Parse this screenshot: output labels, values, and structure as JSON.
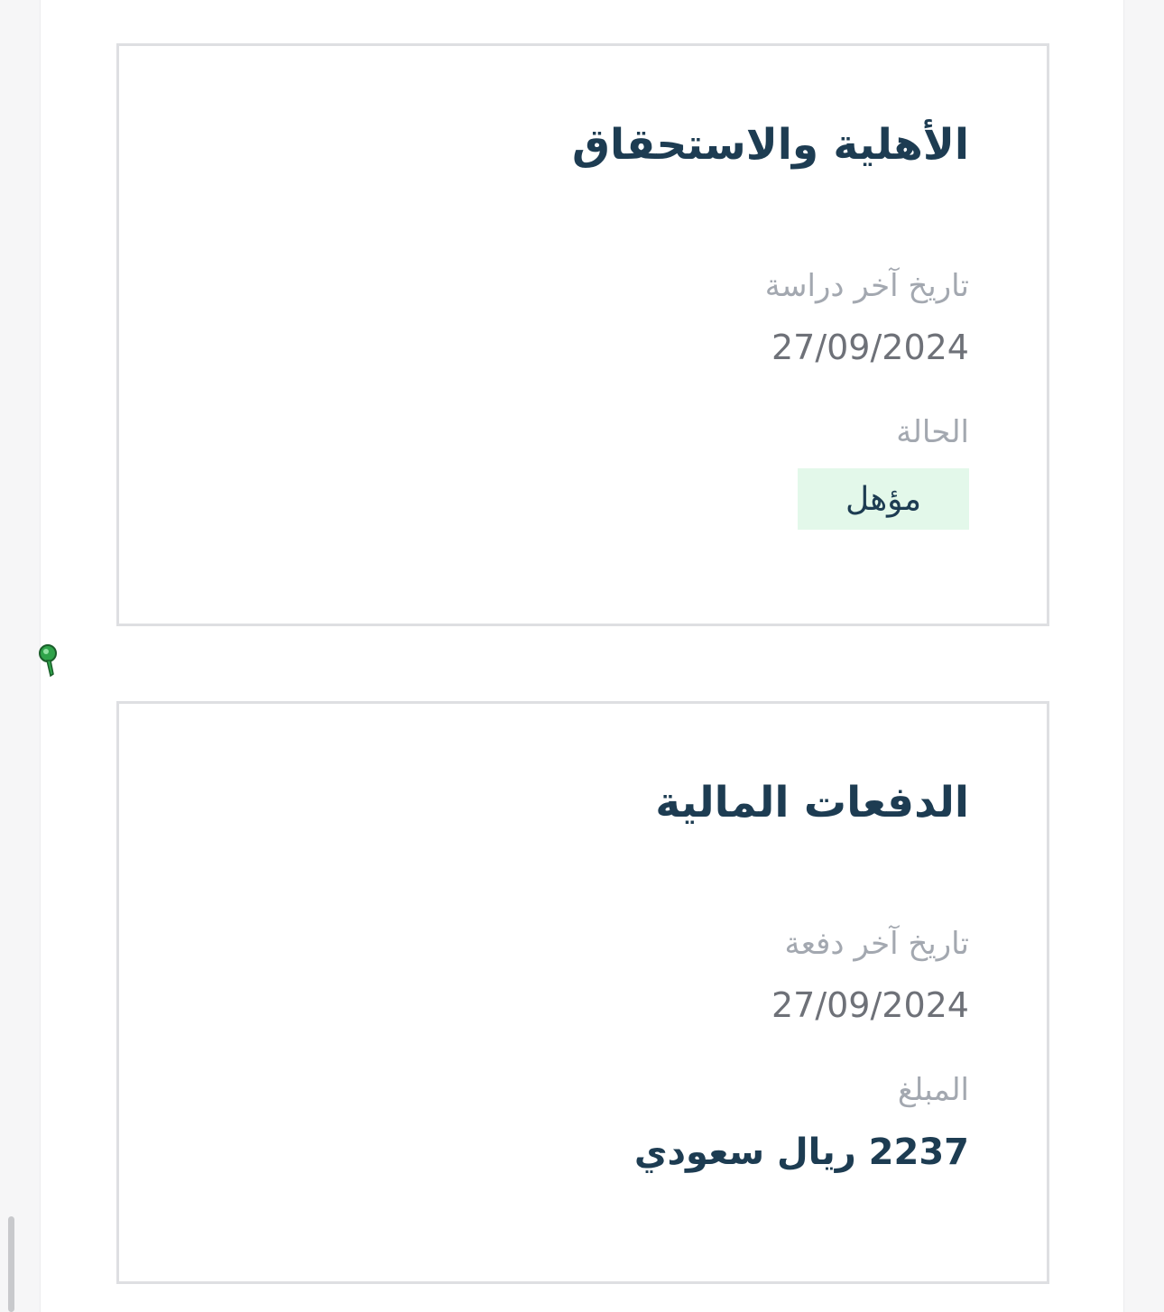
{
  "eligibility_card": {
    "title": "الأهلية والاستحقاق",
    "last_study_label": "تاريخ آخر دراسة",
    "last_study_date": "27/09/2024",
    "status_label": "الحالة",
    "status_value": "مؤهل"
  },
  "payments_card": {
    "title": "الدفعات المالية",
    "last_payment_label": "تاريخ آخر دفعة",
    "last_payment_date": "27/09/2024",
    "amount_label": "المبلغ",
    "amount_value": "2237 ريال سعودي"
  },
  "colors": {
    "title": "#1d3c52",
    "label": "#a3a8b0",
    "value": "#6e7178",
    "badge_bg": "#e3f8ea",
    "card_border": "#dedfe2"
  },
  "icons": {
    "pin": "map-pin-icon"
  }
}
